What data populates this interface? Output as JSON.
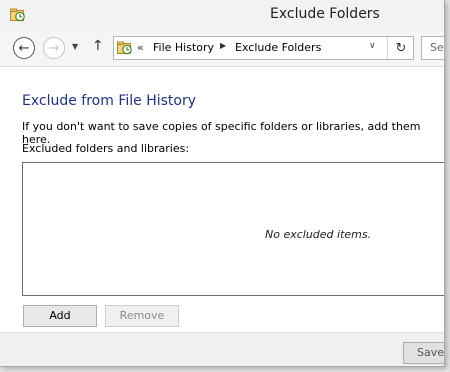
{
  "window": {
    "title": "Exclude Folders"
  },
  "icons": {
    "title_icon": "file-history-icon",
    "back": "back-arrow-icon",
    "forward": "forward-arrow-icon",
    "recent": "chevron-down-icon",
    "up": "up-arrow-icon",
    "location": "file-history-icon",
    "refresh": "refresh-icon"
  },
  "navbar": {
    "back_glyph": "←",
    "forward_glyph": "→",
    "recent_glyph": "▼",
    "up_glyph": "↑",
    "address": {
      "overflow": "«",
      "crumbs": [
        "File History",
        "Exclude Folders"
      ],
      "separator": "▶",
      "dropdown_glyph": "∨",
      "refresh_glyph": "↻"
    },
    "search_placeholder": "Se"
  },
  "content": {
    "heading": "Exclude from File History",
    "description": "If you don't want to save copies of specific folders or libraries, add them here.",
    "list_label": "Excluded folders and libraries:",
    "empty_message": "No excluded items."
  },
  "buttons": {
    "add": "Add",
    "remove": "Remove",
    "save": "Save"
  },
  "colors": {
    "heading": "#1e3287"
  }
}
